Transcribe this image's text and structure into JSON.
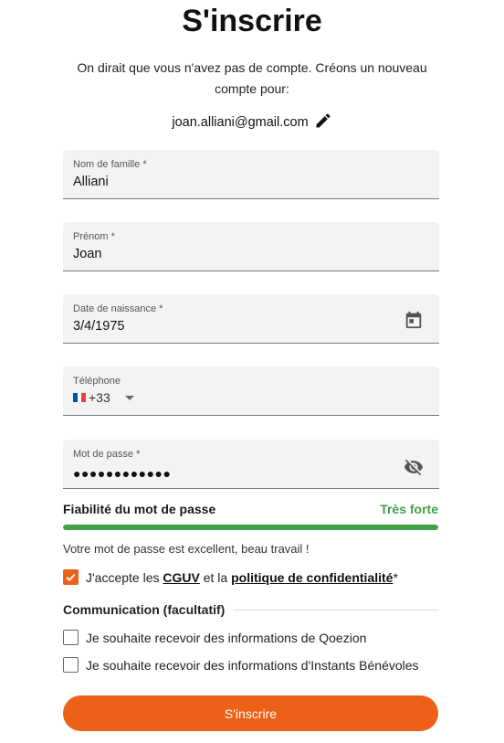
{
  "header": {
    "title": "S'inscrire",
    "intro": "On dirait que vous n'avez pas de compte. Créons un nouveau compte pour:",
    "email": "joan.alliani@gmail.com",
    "edit_icon": "pencil-icon"
  },
  "form": {
    "last_name": {
      "label": "Nom de famille *",
      "value": "Alliani"
    },
    "first_name": {
      "label": "Prénom *",
      "value": "Joan"
    },
    "birth_date": {
      "label": "Date de naissance *",
      "value": "3/4/1975",
      "icon": "calendar-icon"
    },
    "phone": {
      "label": "Téléphone",
      "country_code": "+33",
      "flag": "france-flag"
    },
    "password": {
      "label": "Mot de passe *",
      "masked_value": "●●●●●●●●●●●●",
      "icon": "eye-off-icon"
    }
  },
  "password_strength": {
    "label": "Fiabilité du mot de passe",
    "level": "Très forte",
    "fill_fraction": 1.0,
    "message": "Votre mot de passe est excellent, beau travail !"
  },
  "terms": {
    "checked": true,
    "prefix": "J'accepte les ",
    "cguv_link": "CGUV",
    "middle": " et la ",
    "privacy_link": "politique de confidentialité",
    "suffix": "*"
  },
  "communication": {
    "heading": "Communication (facultatif)",
    "options": [
      {
        "label": "Je souhaite recevoir des informations de Qoezion",
        "checked": false
      },
      {
        "label": "Je souhaite recevoir des informations d'Instants Bénévoles",
        "checked": false
      }
    ]
  },
  "submit": {
    "label": "S'inscrire"
  },
  "colors": {
    "accent": "#ed6018",
    "strength": "#43a047",
    "field_bg": "#f3f3f3"
  }
}
